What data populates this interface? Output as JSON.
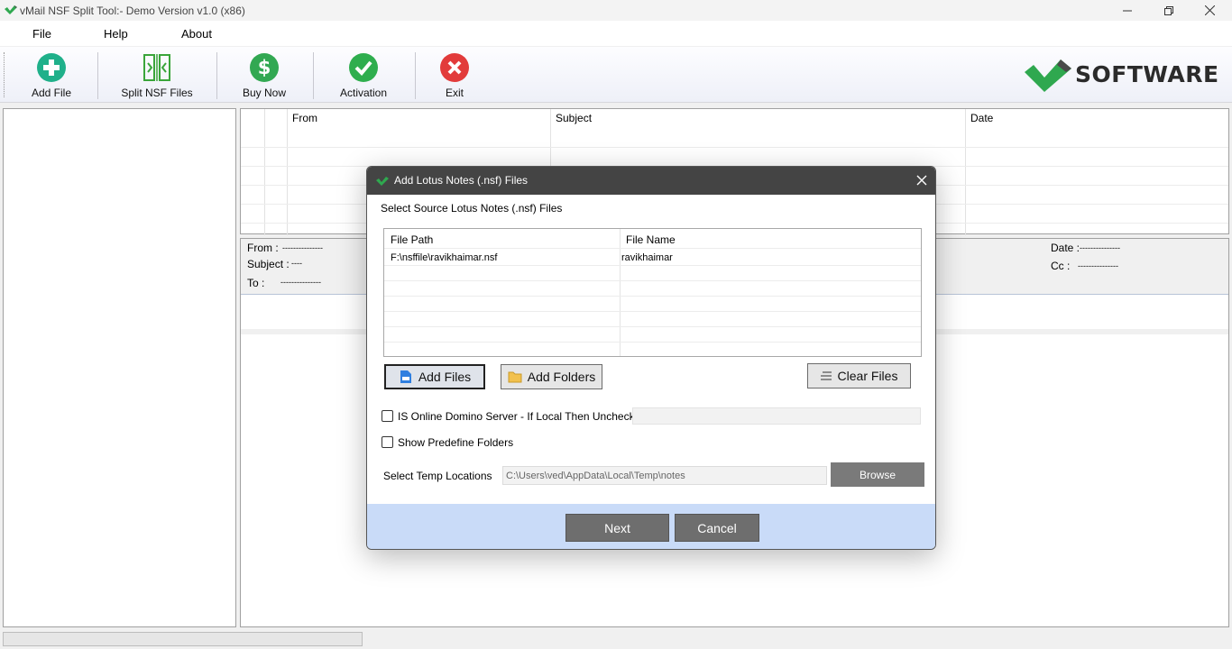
{
  "window": {
    "title": "vMail NSF Split Tool:- Demo Version v1.0 (x86)",
    "controls": [
      "minimize",
      "restore",
      "close"
    ]
  },
  "menu": [
    "File",
    "Help",
    "About"
  ],
  "toolbar": {
    "buttons": [
      {
        "label": "Add File",
        "icon": "plus-circle-icon",
        "color": "#1fb08a"
      },
      {
        "label": "Split NSF Files",
        "icon": "split-icon",
        "color": "#3aa53a"
      },
      {
        "label": "Buy Now",
        "icon": "dollar-icon",
        "color": "#32a852"
      },
      {
        "label": "Activation",
        "icon": "check-circle-icon",
        "color": "#2fae4e"
      },
      {
        "label": "Exit",
        "icon": "x-circle-icon",
        "color": "#e23b3b"
      }
    ],
    "brand": "SOFTWARE"
  },
  "mail_grid": {
    "columns": [
      "",
      "",
      "From",
      "Subject",
      "Date"
    ]
  },
  "preview": {
    "from_label": "From :",
    "from_value": "---------------",
    "subject_label": "Subject :",
    "subject_value": "----",
    "to_label": "To :",
    "to_value": "---------------",
    "date_label": "Date :",
    "date_value": "---------------",
    "cc_label": "Cc :",
    "cc_value": "---------------"
  },
  "dialog": {
    "title": "Add Lotus Notes (.nsf) Files",
    "section_label": "Select Source Lotus Notes (.nsf) Files",
    "table": {
      "headers": [
        "File Path",
        "File Name"
      ],
      "rows": [
        [
          "F:\\nsffile\\ravikhaimar.nsf",
          "ravikhaimar"
        ]
      ]
    },
    "add_files": "Add Files",
    "add_folders": "Add Folders",
    "clear_files": "Clear Files",
    "online_domino": {
      "label": "IS Online Domino Server - If Local Then Unchecked",
      "checked": false
    },
    "predefine": {
      "label": "Show Predefine Folders",
      "checked": false
    },
    "temp_label": "Select Temp Locations",
    "temp_path": "C:\\Users\\ved\\AppData\\Local\\Temp\\notes",
    "browse": "Browse",
    "next": "Next",
    "cancel": "Cancel"
  }
}
